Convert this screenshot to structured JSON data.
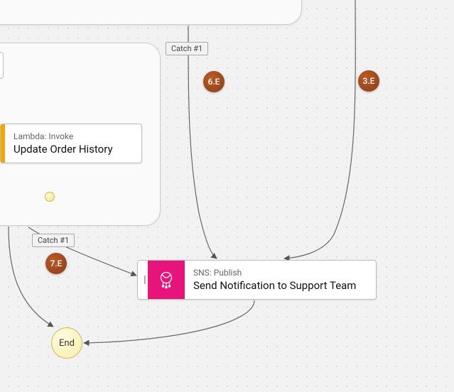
{
  "diagram": {
    "nodes": {
      "lambda_update": {
        "service": "Lambda: Invoke",
        "title": "Update Order History"
      },
      "sns_notify": {
        "service": "SNS: Publish",
        "title": "Send Notification to Support Team"
      },
      "end": {
        "label": "End"
      }
    },
    "catch_tags": {
      "upper": "Catch #1",
      "lower": "Catch #1"
    },
    "markers": {
      "m3e": "3.E",
      "m6e": "6.E",
      "m7e": "7.E"
    }
  }
}
